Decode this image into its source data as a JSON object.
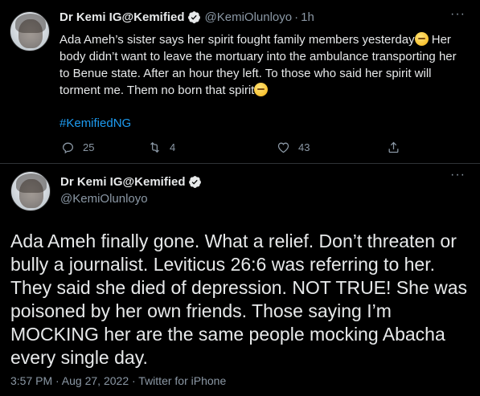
{
  "tweet1": {
    "author_name": "Dr Kemi IG@Kemified",
    "handle": "@KemiOlunloyo",
    "separator": "·",
    "time": "1h",
    "text_part1": "Ada Ameh’s sister says her spirit fought family members yesterday",
    "text_part2": " Her body didn’t want to leave the mortuary into the ambulance transporting her to Benue state. After an hour they left. To those who said her spirit will torment me. Them no born that spirit",
    "hashtag": "#KemifiedNG",
    "replies": "25",
    "retweets": "4",
    "likes": "43",
    "icons": {
      "reply": "reply-icon",
      "retweet": "retweet-icon",
      "like": "heart-icon",
      "share": "share-icon",
      "more": "more-icon",
      "verified": "verified-badge-icon"
    }
  },
  "tweet2": {
    "author_name": "Dr Kemi IG@Kemified",
    "handle": "@KemiOlunloyo",
    "text": "Ada Ameh finally gone. What a relief. Don’t threaten or bully a journalist. Leviticus 26:6 was referring to her. They said she died of depression. NOT TRUE! She was poisoned by her own friends. Those saying I’m MOCKING her are the same people mocking Abacha every single day.",
    "timestamp": "3:57 PM · Aug 27, 2022 · Twitter for iPhone"
  },
  "more_label": "···",
  "colors": {
    "background": "#000000",
    "text": "#e7e9ea",
    "secondary": "#8b98a5",
    "link": "#1d9bf0",
    "divider": "#2f3336"
  }
}
